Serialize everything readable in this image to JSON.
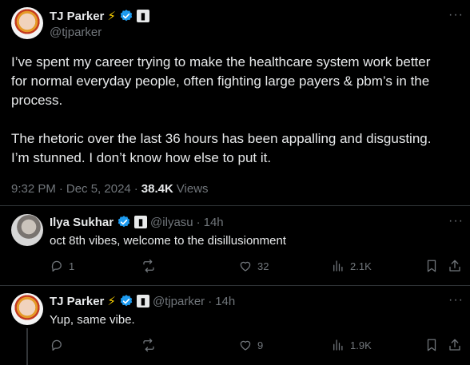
{
  "main_tweet": {
    "display_name": "TJ Parker",
    "bolt": "⚡",
    "handle": "@tjparker",
    "text": "I’ve spent my career trying to make the healthcare system work better\nfor normal everyday people, often fighting large payers & pbm’s in the\nprocess.\n\nThe rhetoric over the last 36 hours has been appalling and disgusting.\nI’m stunned. I don’t know how else to put it.",
    "time": "9:32 PM",
    "dot": "·",
    "date": "Dec 5, 2024",
    "views_count": "38.4K",
    "views_label": "Views"
  },
  "replies": [
    {
      "display_name": "Ilya Sukhar",
      "handle": "@ilyasu",
      "dot": "·",
      "age": "14h",
      "text": "oct 8th vibes, welcome to the disillusionment",
      "reply_count": "1",
      "repost_count": "",
      "like_count": "32",
      "views_count": "2.1K"
    },
    {
      "display_name": "TJ Parker",
      "bolt": "⚡",
      "handle": "@tjparker",
      "dot": "·",
      "age": "14h",
      "text": "Yup, same vibe.",
      "reply_count": "",
      "repost_count": "",
      "like_count": "9",
      "views_count": "1.9K"
    }
  ],
  "more_icon": "···",
  "icons": [
    "reply-icon",
    "repost-icon",
    "like-icon",
    "views-icon",
    "bookmark-icon",
    "share-icon",
    "verified-badge-icon",
    "affiliate-badge-icon",
    "more-icon"
  ],
  "colors": {
    "background": "#000000",
    "text": "#e7e9ea",
    "muted": "#71767b",
    "verified": "#1d9bf0",
    "divider": "#2f3336"
  }
}
